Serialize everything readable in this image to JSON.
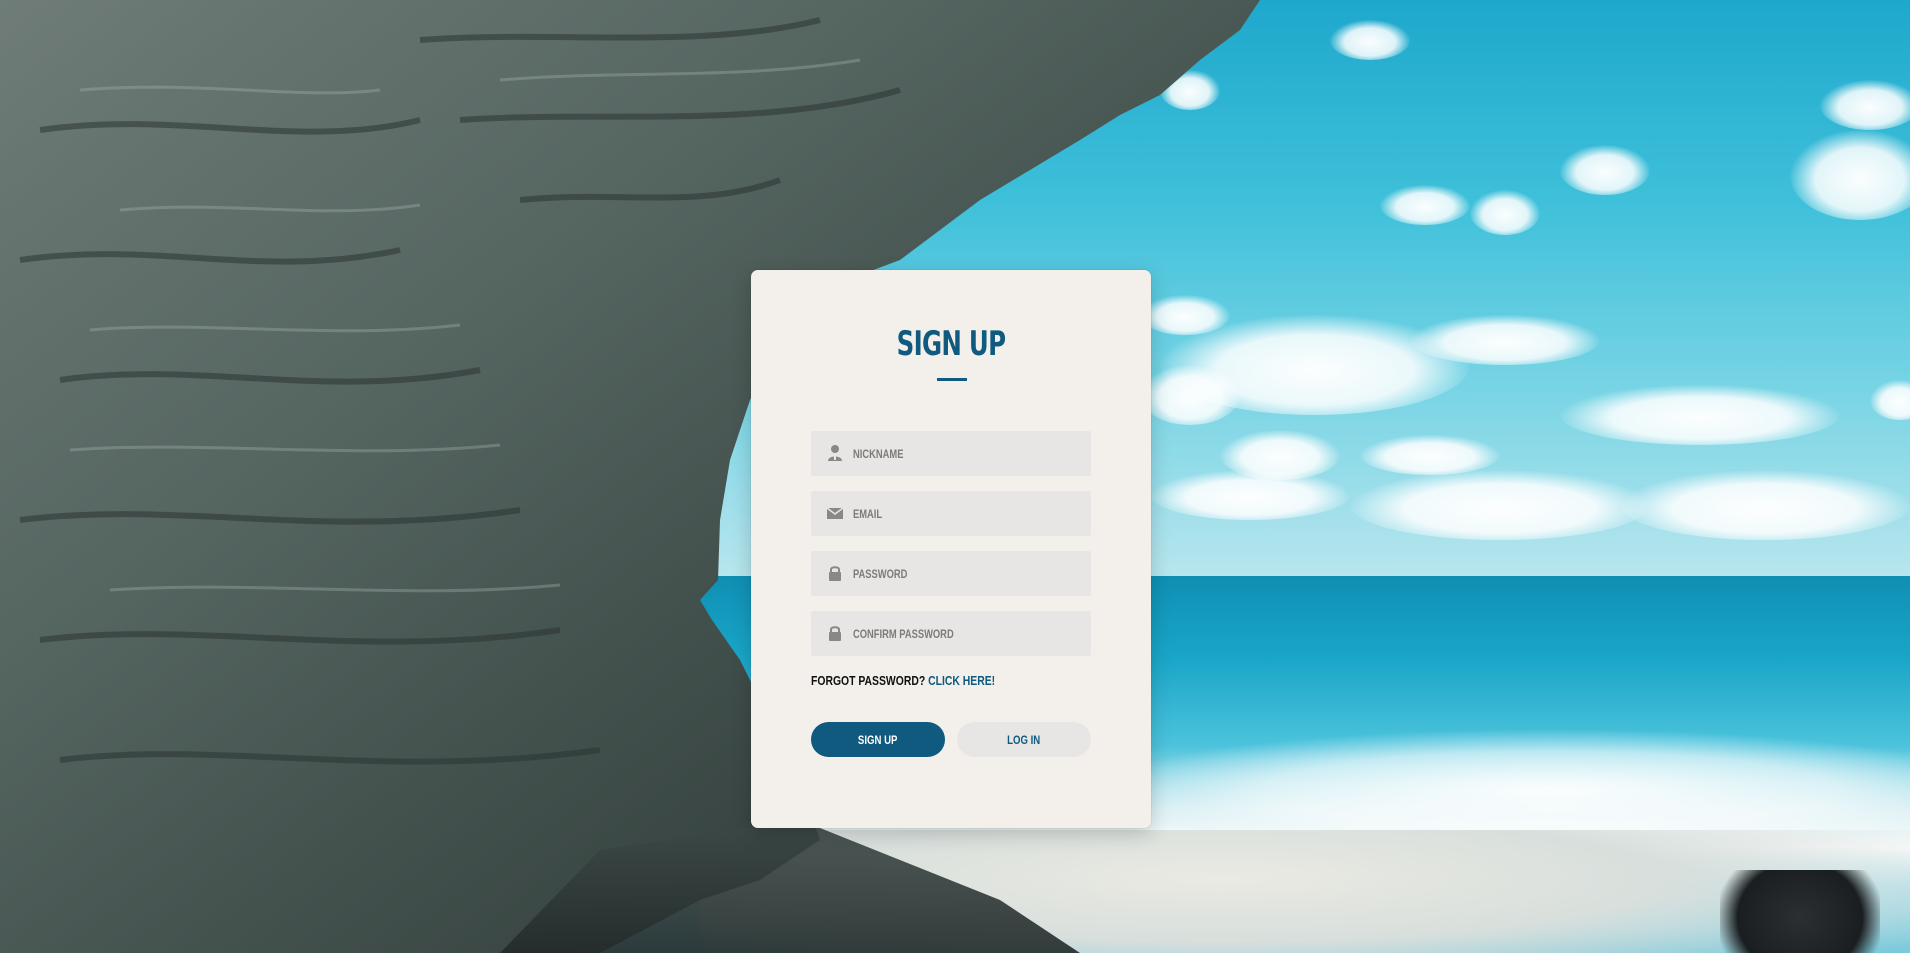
{
  "page": {
    "title": "SIGN UP"
  },
  "form": {
    "fields": [
      {
        "name": "nickname",
        "placeholder": "NICKNAME",
        "icon": "user-icon"
      },
      {
        "name": "email",
        "placeholder": "EMAIL",
        "icon": "envelope-icon"
      },
      {
        "name": "password",
        "placeholder": "PASSWORD",
        "icon": "lock-icon"
      },
      {
        "name": "confirm_password",
        "placeholder": "CONFIRM PASSWORD",
        "icon": "lock-icon"
      }
    ],
    "forgot_text": "FORGOT PASSWORD?",
    "forgot_link": "CLICK HERE!",
    "signup_label": "SIGN UP",
    "login_label": "LOG IN"
  },
  "colors": {
    "accent": "#0f5a7e",
    "card_bg": "#f3f0eb",
    "field_bg": "#e8e6e4",
    "icon": "#8a8786"
  }
}
